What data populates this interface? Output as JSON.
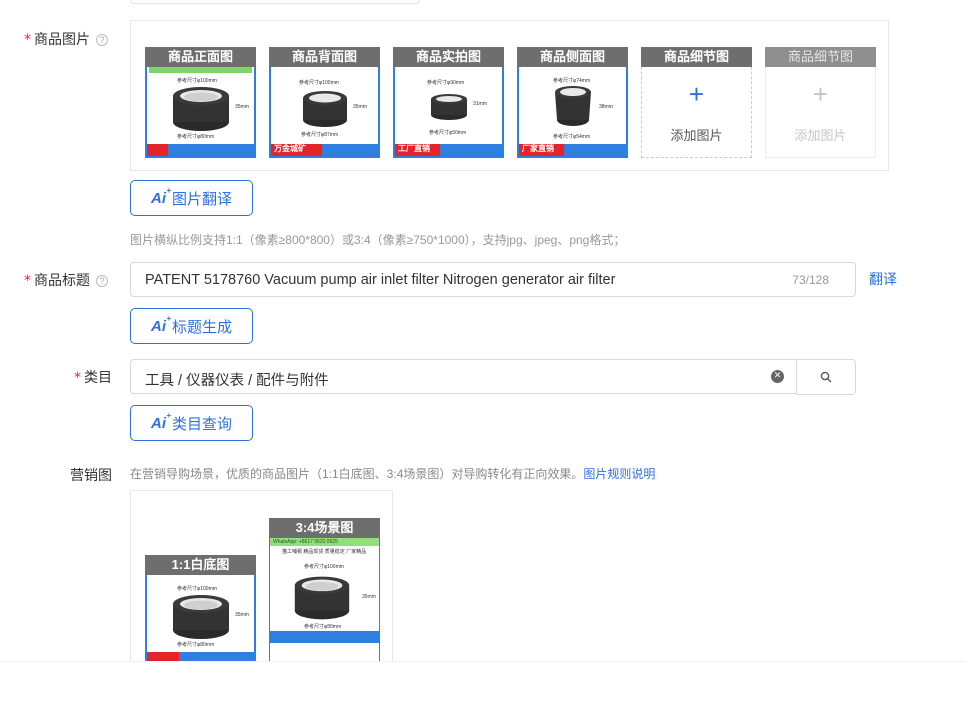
{
  "form": {
    "images": {
      "label": "商品图片",
      "required_mark": "*",
      "help": "?",
      "slots": [
        {
          "caption": "商品正面图",
          "state": "filled",
          "dim_top": "参考尺寸φ100mm",
          "dim_side": "35mm",
          "dim_bottom": "参考尺寸φ80mm",
          "footer_text": ""
        },
        {
          "caption": "商品背面图",
          "state": "filled",
          "dim_top": "参考尺寸φ100mm",
          "dim_side": "35mm",
          "dim_bottom": "参考尺寸φ87mm",
          "footer_text": "万金城矿"
        },
        {
          "caption": "商品实拍图",
          "state": "filled",
          "dim_top": "参考尺寸φ90mm",
          "dim_side": "31mm",
          "dim_bottom": "参考尺寸φ50mm",
          "footer_text": "工厂直销"
        },
        {
          "caption": "商品侧面图",
          "state": "filled",
          "dim_top": "参考尺寸φ74mm",
          "dim_side": "38mm",
          "dim_bottom": "参考尺寸φ54mm",
          "footer_text": "厂家直销"
        },
        {
          "caption": "商品细节图",
          "state": "add",
          "plus": "+",
          "add_text": "添加图片"
        },
        {
          "caption": "商品细节图",
          "state": "disabled",
          "plus": "+",
          "add_text": "添加图片"
        }
      ],
      "ai_button": {
        "icon": "ai-icon",
        "text": "图片翻译"
      },
      "hint": "图片横纵比例支持1:1（像素≥800*800）或3:4（像素≥750*1000），支持jpg、jpeg、png格式；"
    },
    "title": {
      "label": "商品标题",
      "required_mark": "*",
      "help": "?",
      "value": "PATENT 5178760 Vacuum pump air inlet filter Nitrogen generator air filter",
      "counter": "73/128",
      "translate_link": "翻译",
      "ai_button": {
        "icon": "ai-icon",
        "text": "标题生成"
      }
    },
    "category": {
      "label": "类目",
      "required_mark": "*",
      "value": "工具 / 仪器仪表 / 配件与附件",
      "clear_symbol": "✕",
      "ai_button": {
        "icon": "ai-icon",
        "text": "类目查询"
      }
    },
    "marketing": {
      "label": "营销图",
      "hint": "在营销导购场景，优质的商品图片（1:1白底图、3:4场景图）对导购转化有正向效果。",
      "rules_link": "图片规则说明",
      "items": [
        {
          "caption": "1:1白底图",
          "dim_top": "参考尺寸φ100mm",
          "dim_side": "35mm",
          "dim_bottom": "参考尺寸φ80mm"
        },
        {
          "caption": "3:4场景图",
          "banner": "WhatsApp: +8617 9520 0625",
          "sub": "猫工哺顿 精品现货 质量稳定 厂家精品",
          "dim_top": "参考尺寸φ100mm",
          "dim_side": "35mm",
          "dim_bottom": "参考尺寸φ80mm"
        }
      ]
    }
  },
  "colors": {
    "accent": "#2f6fde",
    "required": "#f5222d",
    "caption_bg": "#6e6e6e",
    "product_border": "#2f7fe0",
    "footer_red": "#e3242b"
  }
}
